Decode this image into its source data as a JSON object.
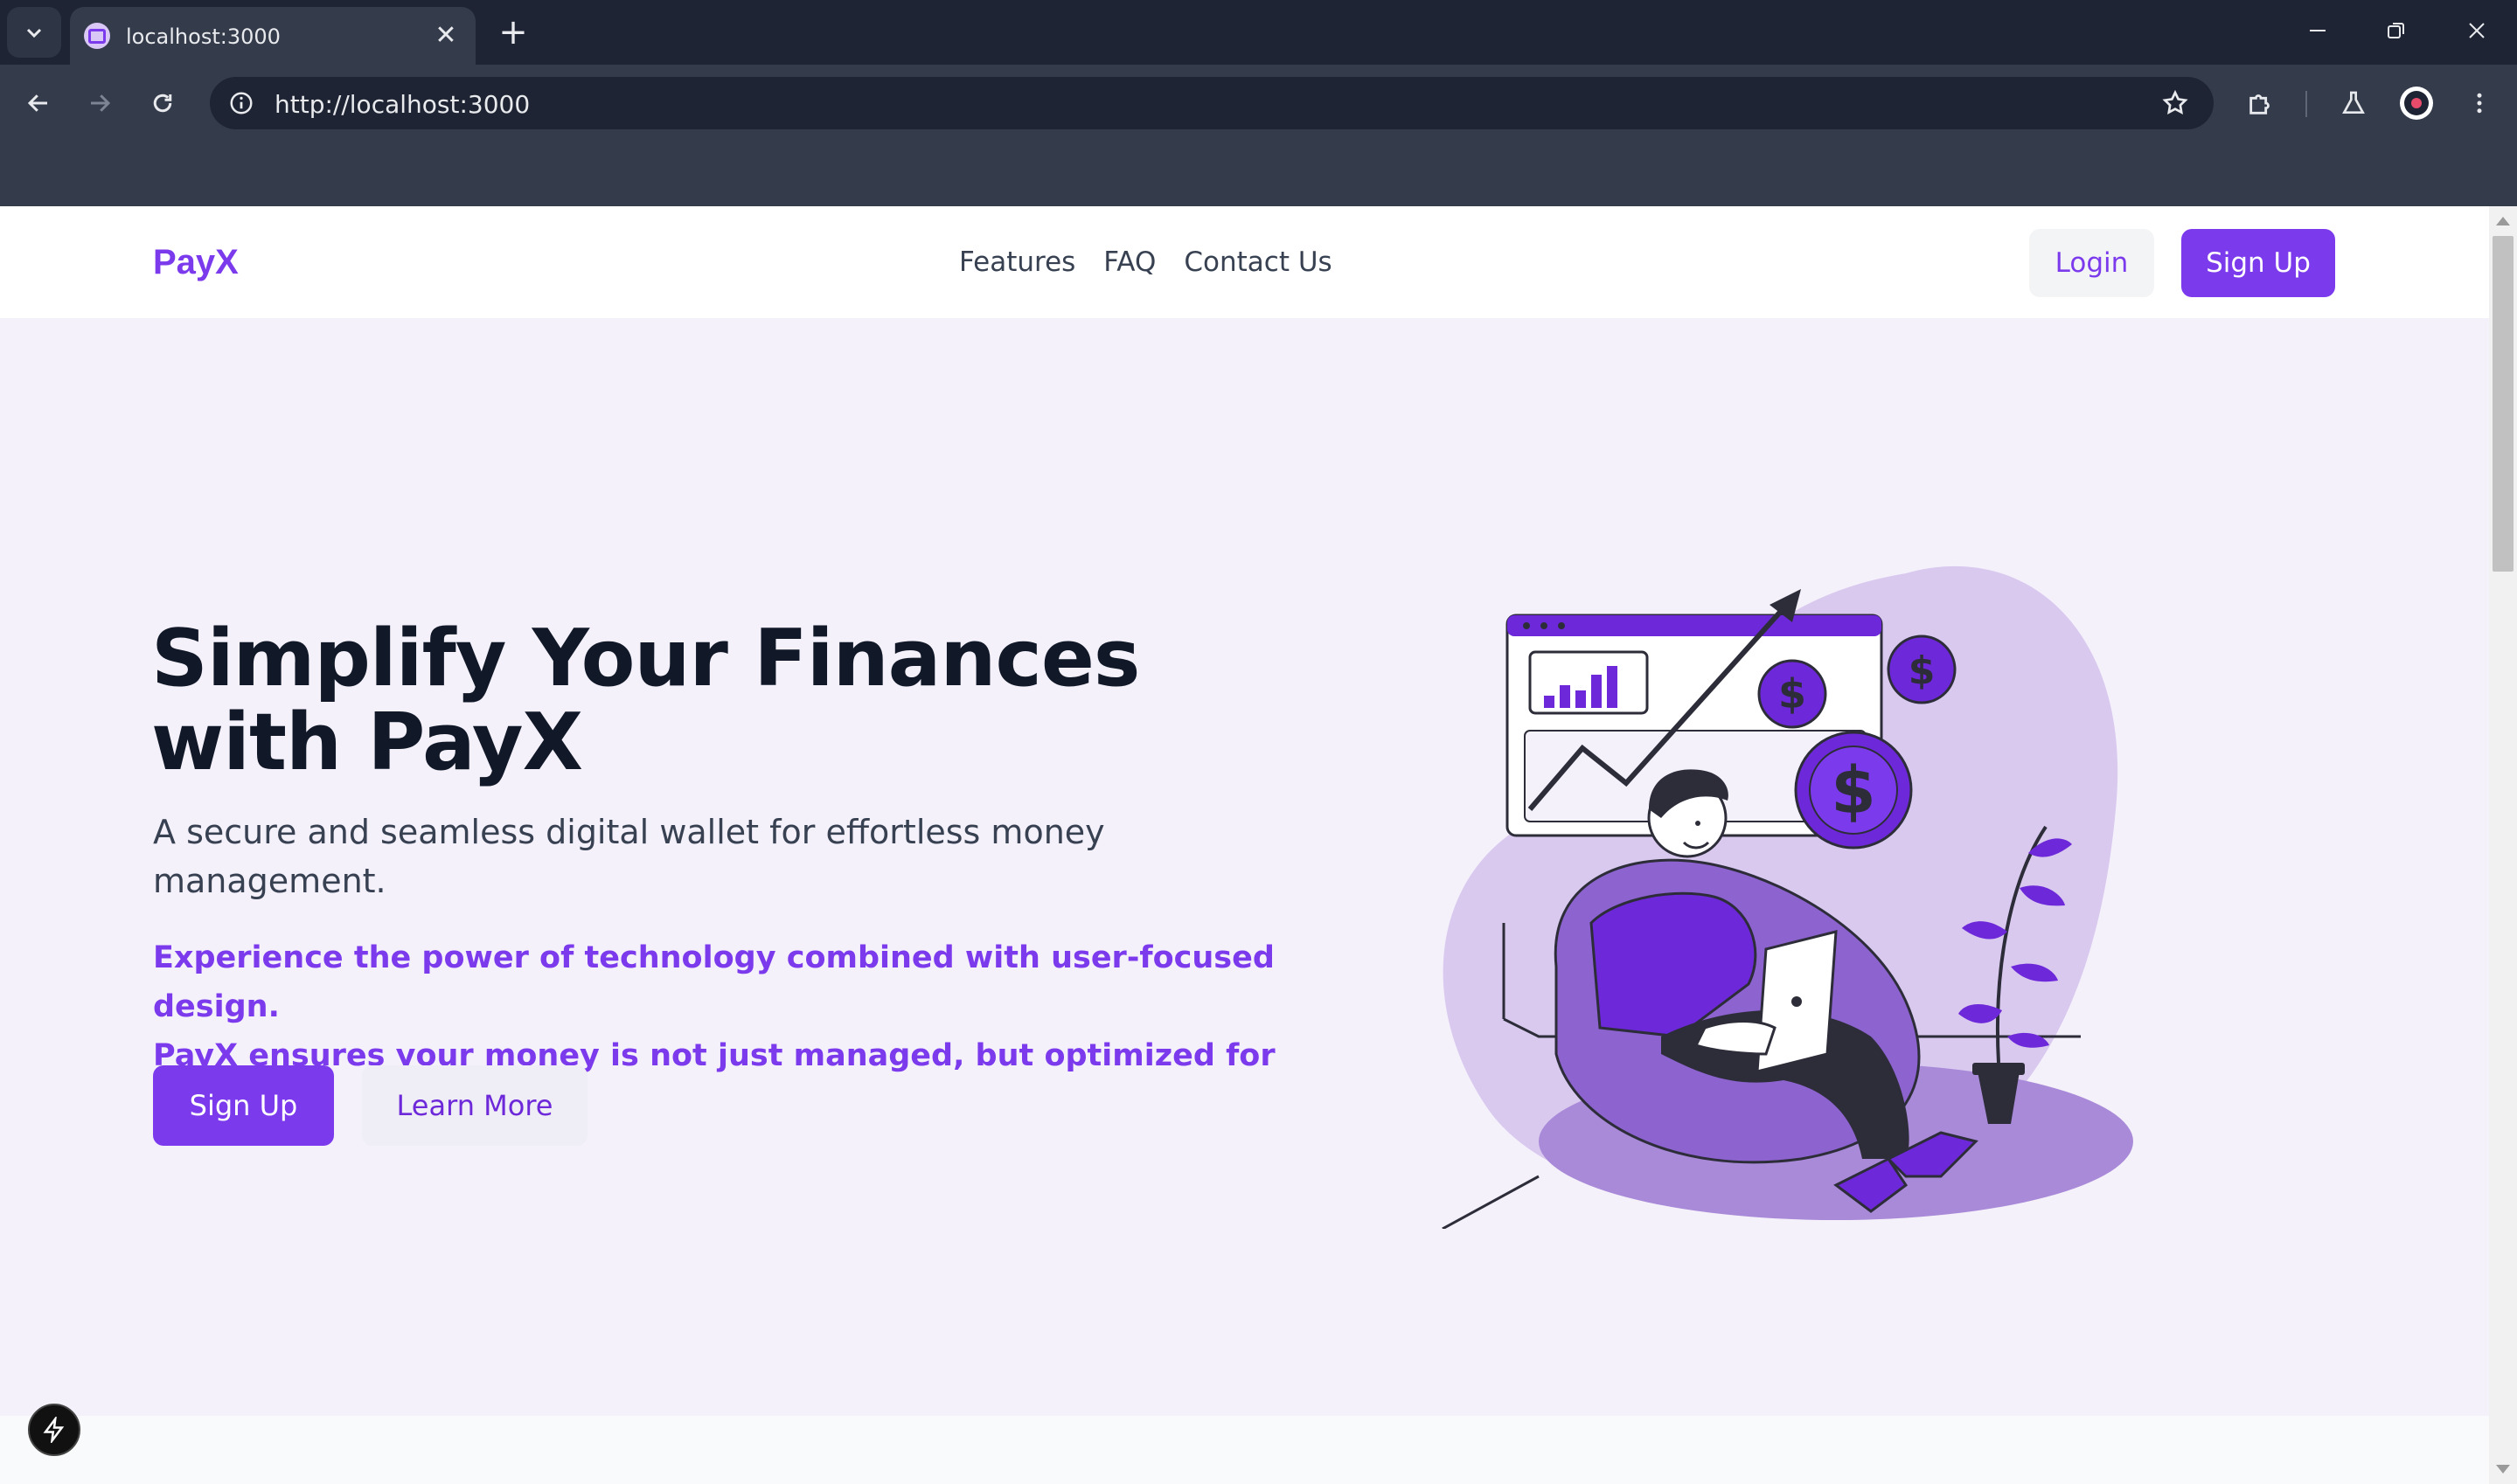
{
  "browser": {
    "tab": {
      "title": "localhost:3000",
      "favicon": "app-favicon-icon"
    },
    "url": "http://localhost:3000",
    "icons": {
      "tab_list": "chevron-down-icon",
      "close_tab": "close-icon",
      "new_tab": "plus-icon",
      "minimize": "minimize-icon",
      "restore": "restore-icon",
      "close_window": "close-icon",
      "back": "back-arrow-icon",
      "forward": "forward-arrow-icon",
      "reload": "reload-icon",
      "site_info": "info-icon",
      "bookmark": "star-icon",
      "extensions": "puzzle-icon",
      "labs": "flask-icon",
      "profile": "profile-avatar-icon",
      "menu": "kebab-menu-icon"
    },
    "tab_close_glyph": "✕",
    "new_tab_glyph": "+"
  },
  "header": {
    "logo": "PayX",
    "nav": [
      "Features",
      "FAQ",
      "Contact Us"
    ],
    "login_label": "Login",
    "signup_label": "Sign Up"
  },
  "hero": {
    "title_line1": "Simplify Your Finances",
    "title_line2": "with PayX",
    "subtitle": "A secure and seamless digital wallet for effortless money management.",
    "description_line1": "Experience the power of technology combined with user-focused design.",
    "description_line2": "PayX ensures your money is not just managed, but optimized for growth.",
    "signup_label": "Sign Up",
    "learn_more_label": "Learn More",
    "illustration": "finance-growth-illustration"
  },
  "colors": {
    "brand": "#7c3aed",
    "heading": "#111827",
    "body_text": "#374151",
    "hero_bg": "#f4f1fb",
    "chrome_dark": "#1e2433",
    "chrome_mid": "#343b4b"
  },
  "dev_badge_icon": "lightning-icon"
}
